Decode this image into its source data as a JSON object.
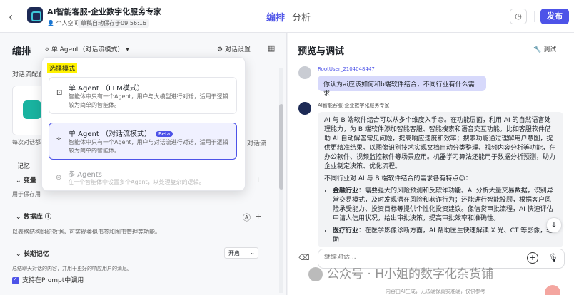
{
  "header": {
    "title": "AI智能客服-企业数字化服务专家",
    "space": "个人空间",
    "draft_status": "草稿自动保存于09:56:16",
    "tabs": [
      "编排",
      "分析"
    ],
    "publish_label": "发布"
  },
  "left_panel": {
    "title": "编排",
    "mode_trigger": "单 Agent（对话流模式）",
    "settings_label": "对话设置",
    "config_title": "对话流配置",
    "desc_cut": "每次对话都会",
    "right_mini": "对话流",
    "memory_title": "记忆",
    "variable_label": "变量",
    "variable_desc": "用于保存用",
    "database_label": "数据库",
    "database_desc": "以表格结构组织数据，可实现类似书签和图书管理等功能。",
    "ltm_label": "长期记忆",
    "ltm_value": "开启",
    "ltm_desc": "总结聊天对话的内容，并用于更好的响应用户的消息。",
    "support_label": "支持在Prompt中调用"
  },
  "mode_popover": {
    "title": "选择模式",
    "options": [
      {
        "title": "单 Agent （LLM模式）",
        "desc": "智能体中只有一个Agent，用户与大模型进行对话，适用于逻辑较为简单的智能体。",
        "icon": "llm-icon"
      },
      {
        "title": "单 Agent （对话流模式）",
        "badge": "Beta",
        "desc": "智能体中只有一个Agent，用户与对话流进行对话，适用于逻辑较为简单的智能体。",
        "icon": "flow-icon"
      },
      {
        "title": "多 Agents",
        "desc": "在一个智能体中设置多个Agent，以处理复杂的逻辑。",
        "icon": "multi-agent-icon"
      }
    ]
  },
  "right_panel": {
    "title": "预览与调试",
    "debug_label": "调试",
    "user_name": "RootUser_2104048447",
    "user_message": "你认为ai应该如何和b端软件结合，不同行业有什么需求",
    "bot_name": "AI智能客服-企业数字化服务专家",
    "bot_p1": "AI 与 B 端软件结合可以从多个维度入手😊。在功能层面，利用 AI 的自然语言处理能力，为 B 端软件添加智能客服、智能搜索和语音交互功能。比如客服软件借助 AI 自动解答常见问题，提高响应速度和效率；搜索功能通过理解用户意图，提供更精准结果。以图像识别技术实现文档自动分类整理、视频内容分析等功能，在办公软件、视频监控软件等场景应用。机器学习算法还能用于数据分析预测，助力企业制定决策、优化流程。",
    "bot_p2": "不同行业对 AI 与 B 端软件结合的需求各有特点😊：",
    "bot_li1_head": "金融行业",
    "bot_li1_body": "：需要强大的风险预测和反欺诈功能。AI 分析大量交易数据，识别异常交易模式，及时发现潜在风险和欺诈行为；还能进行智能投顾，根据客户风险承受能力、投资目标等提供个性化投资建议。像信贷审批流程，AI 快速评估申请人信用状况，给出审批决策，提高审批效率和准确性。",
    "bot_li2_head": "医疗行业",
    "bot_li2_body": "：在医学影像诊断方面，AI 帮助医生快速解读 X 光、CT 等影像，辅助",
    "input_placeholder": "继续对话..."
  },
  "watermark": "公众号 · H小姐的数字化杂货铺",
  "footer_note": "内容由AI生成，无法确保真实准确，仅供参考",
  "colors": {
    "accent": "#4d53e8",
    "highlight": "#fff200",
    "bubble_user": "#d7d9fb"
  }
}
